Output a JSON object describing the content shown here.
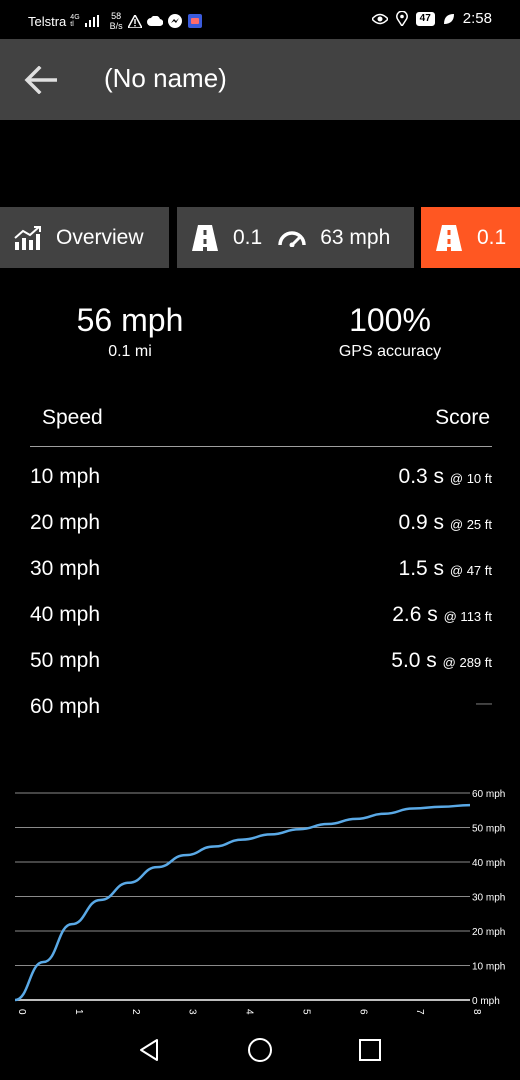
{
  "status_bar": {
    "carrier": "Telstra",
    "network_top": "4G",
    "network_bottom": "tl",
    "speed_value": "58",
    "speed_unit": "B/s",
    "battery": "47",
    "time": "2:58"
  },
  "app_bar": {
    "title": "(No name)"
  },
  "tabs": {
    "overview_label": "Overview",
    "run1_distance": "0.1",
    "run1_speed": "63 mph",
    "run2_distance": "0.1"
  },
  "summary": {
    "speed_value": "56 mph",
    "speed_sub": "0.1 mi",
    "accuracy_value": "100%",
    "accuracy_sub": "GPS accuracy"
  },
  "table": {
    "header_speed": "Speed",
    "header_score": "Score",
    "rows": [
      {
        "speed": "10 mph",
        "time": "0.3 s",
        "dist": "@ 10 ft"
      },
      {
        "speed": "20 mph",
        "time": "0.9 s",
        "dist": "@ 25 ft"
      },
      {
        "speed": "30 mph",
        "time": "1.5 s",
        "dist": "@ 47 ft"
      },
      {
        "speed": "40 mph",
        "time": "2.6 s",
        "dist": "@ 113 ft"
      },
      {
        "speed": "50 mph",
        "time": "5.0 s",
        "dist": "@ 289 ft"
      },
      {
        "speed": "60 mph",
        "time": "",
        "dist": "",
        "dash": "—"
      }
    ]
  },
  "colors": {
    "accent": "#ff5722",
    "bar": "#424242",
    "line": "#5aa9e6"
  },
  "chart_data": {
    "type": "line",
    "x": [
      0,
      0.5,
      1,
      1.5,
      2,
      2.5,
      3,
      3.5,
      4,
      4.5,
      5,
      5.5,
      6,
      6.5,
      7,
      7.5,
      8
    ],
    "series": [
      {
        "values": [
          0,
          11,
          22,
          29,
          34,
          38.5,
          42,
          44.5,
          46.5,
          48,
          49.5,
          51,
          52.5,
          54,
          55.5,
          56,
          56.5
        ]
      }
    ],
    "x_ticks": [
      "0",
      "1",
      "2",
      "3",
      "4",
      "5",
      "6",
      "7",
      "8"
    ],
    "y_ticks": [
      "0 mph",
      "10 mph",
      "20 mph",
      "30 mph",
      "40 mph",
      "50 mph",
      "60 mph"
    ],
    "xlim": [
      0,
      8
    ],
    "ylim": [
      0,
      60
    ],
    "grid": true
  }
}
